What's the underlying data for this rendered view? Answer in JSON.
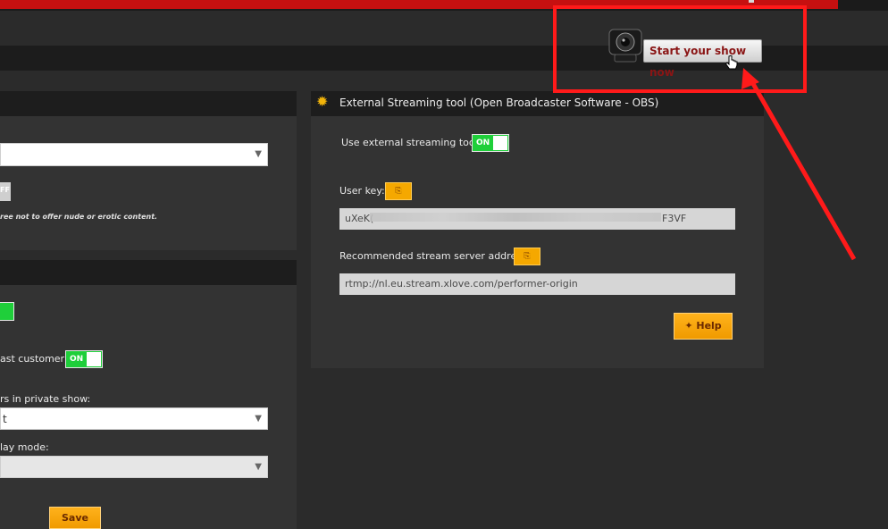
{
  "header": {
    "start_show_label": "Start your show now"
  },
  "left_panel": {
    "toggle_off_partial": "FF",
    "note_partial": "ree not to offer nude or erotic content.",
    "broadcast_label_partial": "ast customer",
    "broadcast_toggle": "ON",
    "private_show_label_partial": "rs in private show:",
    "private_show_value_partial": "t",
    "display_mode_label_partial": "lay mode:",
    "save_label": "Save"
  },
  "obs_panel": {
    "title": "External Streaming tool (Open Broadcaster Software - OBS)",
    "use_external_label": "Use external streaming tool",
    "use_external_toggle": "ON",
    "user_key_label": "User key:",
    "user_key_prefix": "uXeK(",
    "user_key_suffix": "F3VF",
    "server_label": "Recommended stream server address:",
    "server_value": "rtmp://nl.eu.stream.xlove.com/performer-origin",
    "help_label": "Help"
  },
  "colors": {
    "accent_red": "#c61010",
    "highlight": "#ff1a1a",
    "toggle_on": "#1fcf3a",
    "button_orange": "#f5a800"
  },
  "icons": [
    "camera-icon",
    "gear-icon",
    "copy-icon",
    "lightbulb-icon",
    "hand-cursor-icon",
    "chevron-down-icon"
  ]
}
